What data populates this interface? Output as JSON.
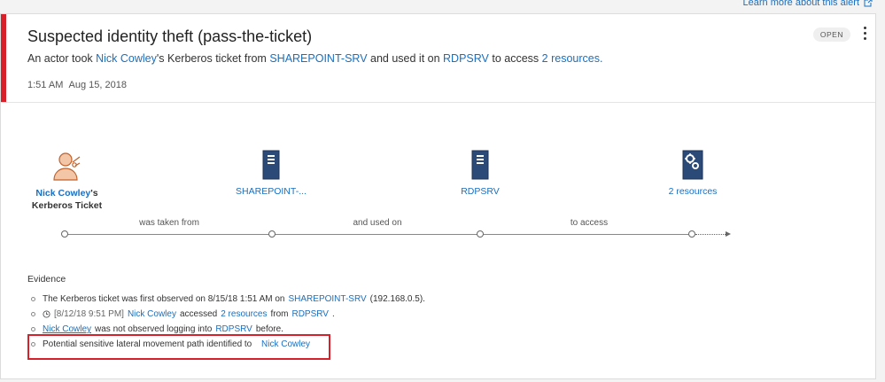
{
  "learn_more": "Learn more about this alert",
  "alert": {
    "title": "Suspected identity theft (pass-the-ticket)",
    "status": "OPEN",
    "desc": {
      "p1": "An actor took ",
      "actor": "Nick Cowley",
      "p2": "'s Kerberos ticket from ",
      "source": "SHAREPOINT-SRV",
      "p3": " and used it on ",
      "target": "RDPSRV",
      "p4": " to access ",
      "resources": "2 resources.",
      "p5": ""
    },
    "time": "1:51 AM",
    "date": "Aug 15, 2018"
  },
  "flow": {
    "nodes": [
      {
        "icon": "user-ticket-icon",
        "name": "Nick Cowley",
        "suffix": "'s",
        "sub": "Kerberos Ticket"
      },
      {
        "icon": "server-icon",
        "name": "SHAREPOINT-..."
      },
      {
        "icon": "server-icon",
        "name": "RDPSRV"
      },
      {
        "icon": "gears-icon",
        "name": "2 resources"
      }
    ],
    "edges": [
      "was taken from",
      "and used on",
      "to access"
    ]
  },
  "evidence": {
    "title": "Evidence",
    "items": [
      {
        "parts": [
          "The Kerberos ticket was first observed on 8/15/18 1:51 AM on ",
          "SHAREPOINT-SRV",
          " (192.168.0.5)."
        ]
      },
      {
        "icon": "clock-icon",
        "parts": [
          "[8/12/18 9:51 PM] ",
          "Nick Cowley",
          " accessed ",
          "2 resources",
          " from ",
          "RDPSRV",
          "."
        ]
      },
      {
        "parts": [
          "Nick Cowley",
          " was not observed logging into ",
          "RDPSRV",
          " before."
        ]
      },
      {
        "parts": [
          "Potential sensitive lateral movement path identified to ",
          "Nick Cowley"
        ]
      }
    ]
  },
  "colors": {
    "accent": "#1a6fbf",
    "alert_red": "#d8202a"
  }
}
